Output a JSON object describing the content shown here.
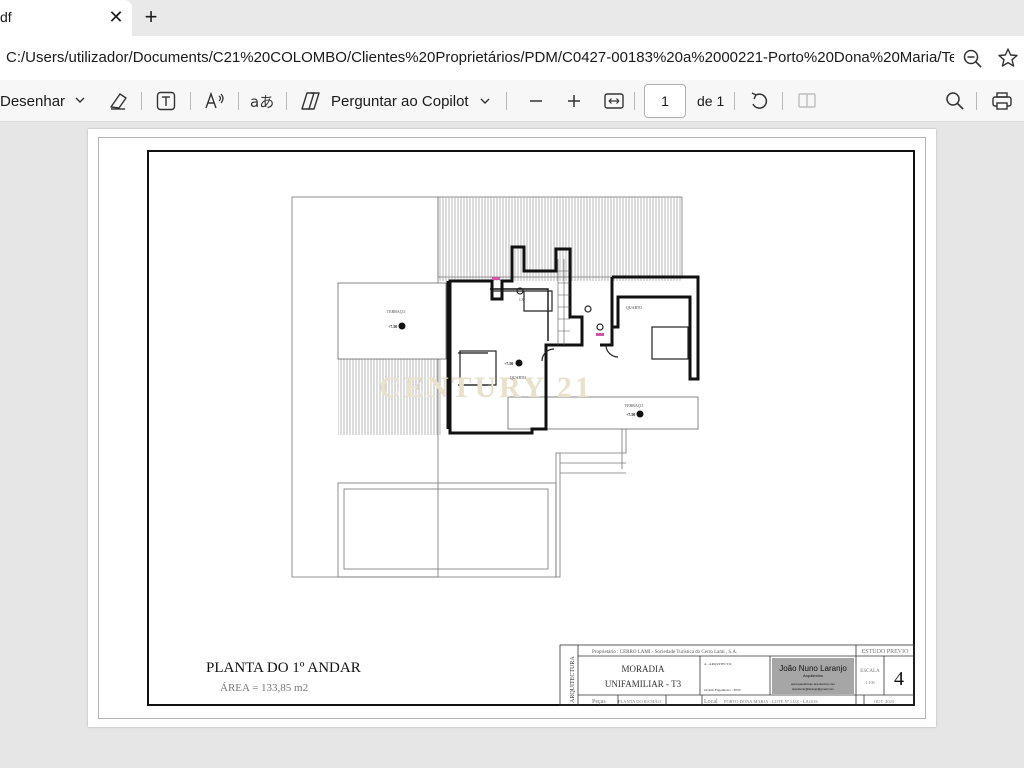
{
  "tab": {
    "title": "df",
    "close_label": "✕",
    "new_tab_label": "+"
  },
  "address": {
    "url": "C:/Users/utilizador/Documents/C21%20COLOMBO/Clientes%20Proprietários/PDM/C0427-00183%20a%2000221-Porto%20Dona%20Maria/Ter..."
  },
  "toolbar": {
    "draw_label": "Desenhar",
    "copilot_label": "Perguntar ao Copilot",
    "page_current": "1",
    "page_total": "de 1"
  },
  "drawing": {
    "watermark": "CENTURY 21",
    "plan_title": "PLANTA DO 1º ANDAR",
    "plan_area": "ÁREA = 133,85 m2",
    "room_labels": [
      "TERRAÇO",
      "I.S.",
      "QUARTO",
      "QUARTO",
      "TERRAÇO"
    ],
    "level_marks": [
      "+7.50",
      "+7.50",
      "+7.50"
    ],
    "title_block": {
      "discipline": "ARQUITECTURA",
      "owner": "Proprietário : CERRO LAMI - Sociedade Turística do Cerro Lami , S.A.",
      "project_line1": "MORADIA",
      "project_line2": "UNIFAMILIAR - T3",
      "phase_small": "A - ARQUITECTO",
      "order": "Ordem Engenheiro : 3650",
      "architect_name": "João Nuno Laranjo",
      "architect_role": "Arquitectos",
      "architect_web": "www.joaolaranjo-arquitectos.com",
      "architect_email": "arquitecto@laranjo@gmail.com",
      "stage": "ESTUDO PREVIO",
      "scale_label": "ESCALA",
      "scale_value": "1:100",
      "sheet_number": "4",
      "pieces_label": "Peças",
      "pieces_value": "PLANTA DO R/CHÃO",
      "location_label": "Local",
      "location_value": "PORTO DONA MARIA - LOTE Nº LUZ - LAGOS",
      "date": "OUT. 2025"
    }
  }
}
